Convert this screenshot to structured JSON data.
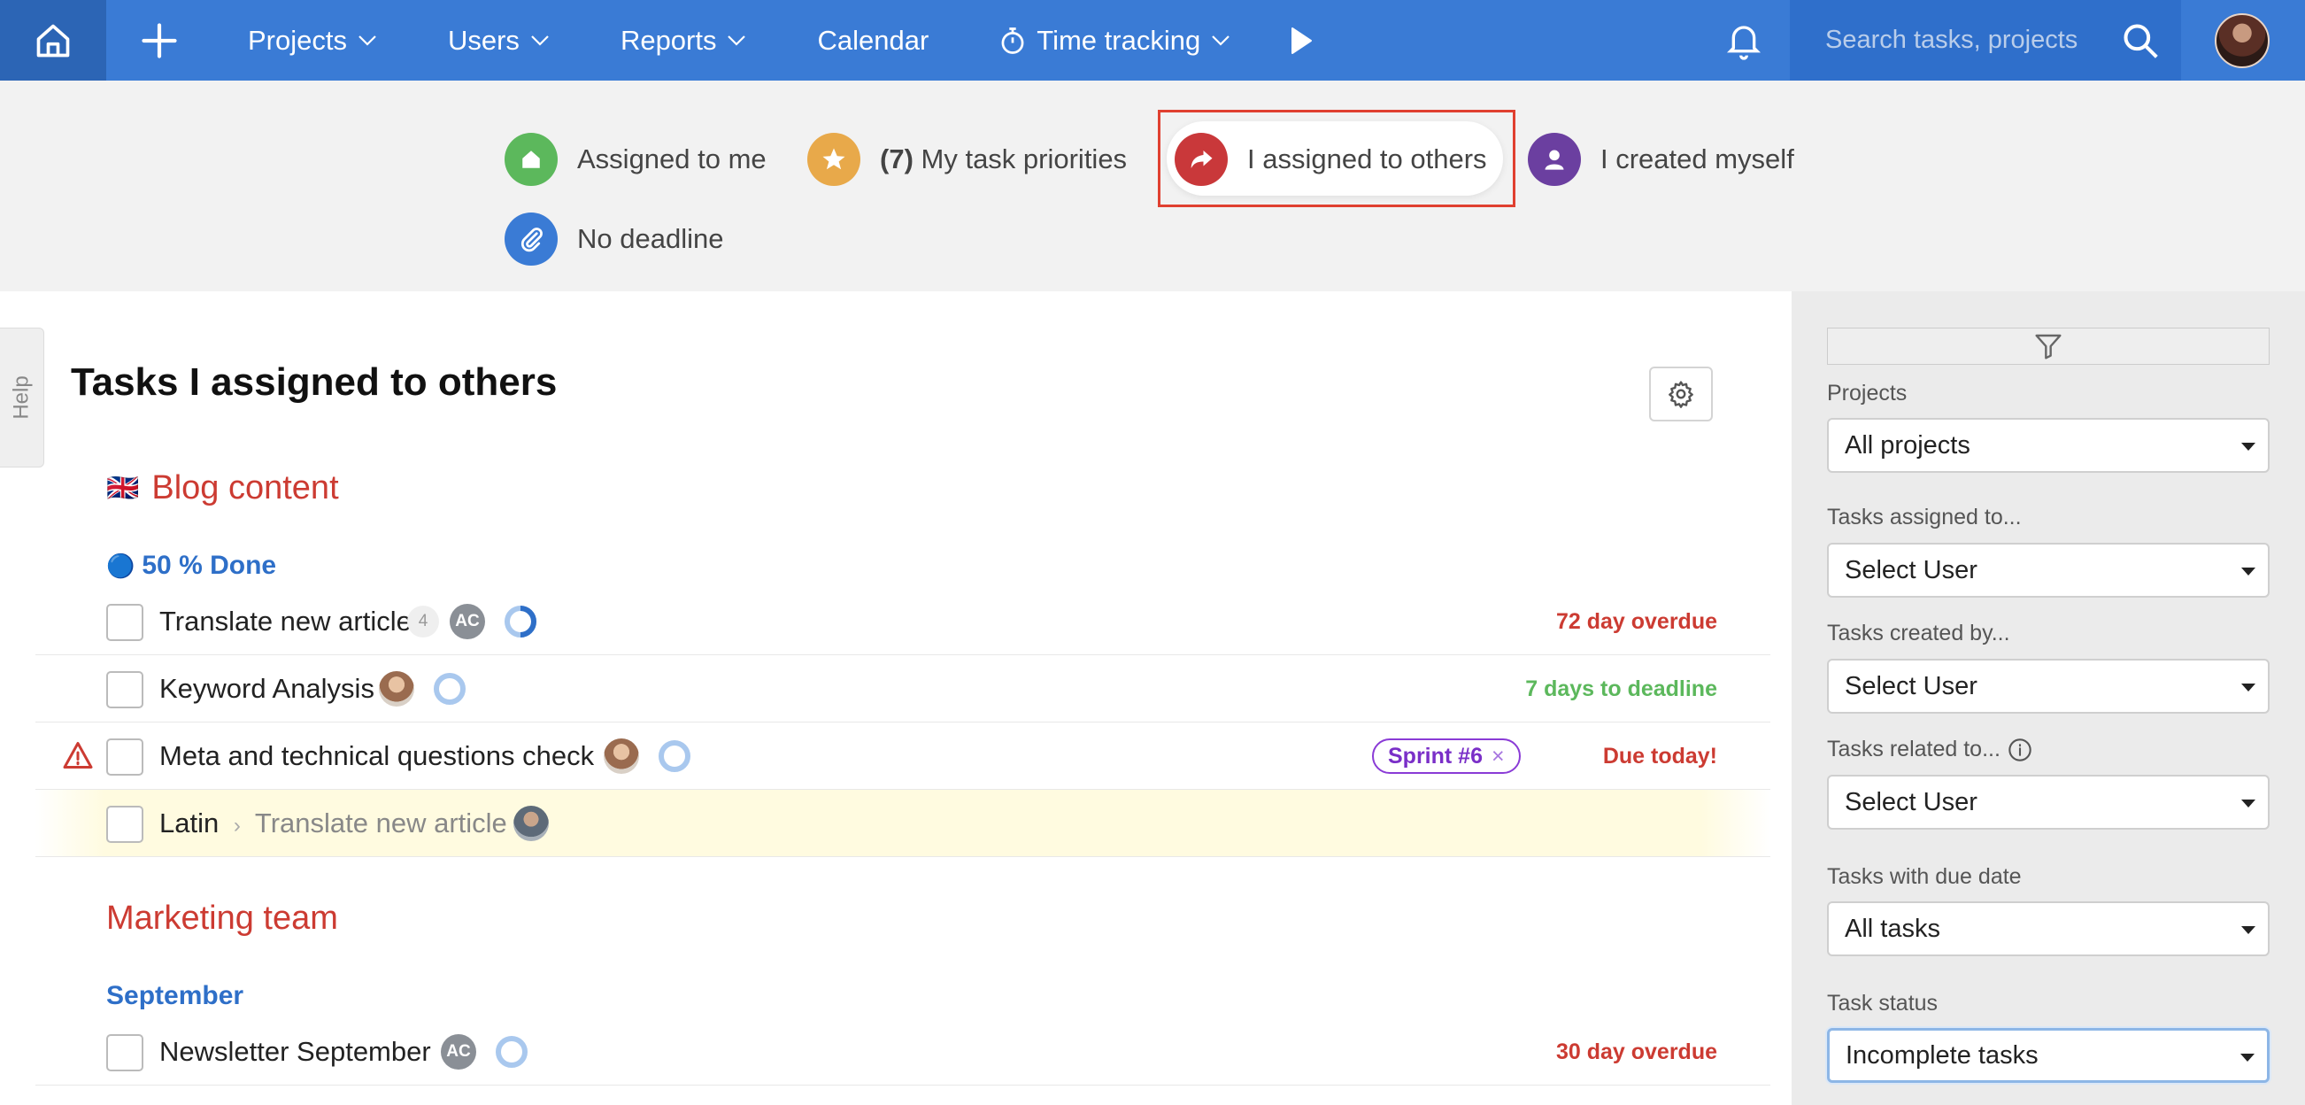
{
  "topbar": {
    "nav": [
      {
        "label": "Projects",
        "dropdown": true
      },
      {
        "label": "Users",
        "dropdown": true
      },
      {
        "label": "Reports",
        "dropdown": true
      },
      {
        "label": "Calendar",
        "dropdown": false
      },
      {
        "label": "Time tracking",
        "dropdown": true
      }
    ],
    "search_placeholder": "Search tasks, projects"
  },
  "chips": {
    "assigned_to_me": "Assigned to me",
    "priorities_count": "(7)",
    "priorities_label": "My task priorities",
    "assigned_to_others": "I assigned to others",
    "created_myself": "I created myself",
    "no_deadline": "No deadline"
  },
  "main": {
    "title": "Tasks I assigned to others",
    "help_label": "Help",
    "projects": [
      {
        "flag": "🇬🇧",
        "name": "Blog content",
        "group": {
          "bullet": "🔵",
          "name": "50 % Done"
        },
        "tasks": [
          {
            "name": "Translate new article",
            "comments": "4",
            "assignee": "AC",
            "due": "72 day overdue"
          },
          {
            "name": "Keyword Analysis",
            "due": "7 days to deadline"
          },
          {
            "name": "Meta and technical questions check",
            "tag": "Sprint #6",
            "tag_close": "×",
            "due": "Due today!"
          },
          {
            "name": "Latin",
            "parent": "Translate new article"
          }
        ]
      },
      {
        "name": "Marketing team",
        "group": {
          "name": "September"
        },
        "tasks": [
          {
            "name": "Newsletter September",
            "assignee": "AC",
            "due": "30 day overdue"
          }
        ]
      }
    ]
  },
  "sidebar": {
    "projects_label": "Projects",
    "projects_value": "All projects",
    "assigned_label": "Tasks assigned to...",
    "assigned_value": "Select User",
    "created_label": "Tasks created by...",
    "created_value": "Select User",
    "related_label": "Tasks related to...",
    "related_value": "Select User",
    "due_label": "Tasks with due date",
    "due_value": "All tasks",
    "status_label": "Task status",
    "status_value": "Incomplete tasks"
  },
  "colors": {
    "topbar": "#3a7bd5",
    "project_title": "#cc3b32",
    "group_title": "#2e6fc8",
    "overdue": "#cc3b32",
    "deadline_ok": "#5cb85c",
    "sprint_tag": "#8a3bd6",
    "chip_assigned_to_me": "#5cb85c",
    "chip_priorities": "#e8a94a",
    "chip_assigned_to_others": "#c9383a",
    "chip_created_myself": "#6b3fa0",
    "chip_no_deadline": "#3a7bd5"
  },
  "icons": [
    "home-icon",
    "plus-icon",
    "chevron-down-icon",
    "stopwatch-icon",
    "play-icon",
    "bell-icon",
    "search-icon",
    "star-icon",
    "share-arrow-icon",
    "user-icon",
    "paperclip-icon",
    "gear-icon",
    "warning-icon",
    "filter-icon",
    "info-icon",
    "chevron-right-icon"
  ]
}
